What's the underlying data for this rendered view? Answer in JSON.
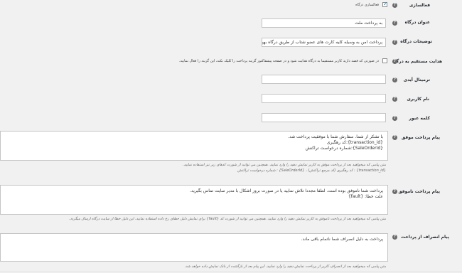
{
  "fields": {
    "enabled": {
      "label": "فعالسازی",
      "checkbox_label": "فعالسازی درگاه"
    },
    "title": {
      "label": "عنوان درگاه",
      "value": "به پرداخت ملت"
    },
    "description": {
      "label": "توضیحات درگاه",
      "value": "پرداخت امن به وسیله کلیه کارت های عضو شتاب از طریق درگاه بهپرداخت ملت"
    },
    "direct_redirect": {
      "label": "هدایت مستقیم به درگاه",
      "checkbox_label": "در صورتی که قصد دارید کاربر مستقیما به درگاه هدایت شود و در صفحه پیشفاکتور گزینه پرداخت را کلیک نکند، این گزینه را فعال نمایید."
    },
    "terminal": {
      "label": "ترمینال آیدی",
      "value": ""
    },
    "username": {
      "label": "نام کاربری",
      "value": ""
    },
    "password": {
      "label": "کلمه عبور",
      "value": ""
    },
    "success_message": {
      "label": "پیام پرداخت موفق",
      "lines": [
        "با تشکر از شما. سفارش شما با موفقیت پرداخت شد.",
        "{transaction_id}:کد رهگیری",
        "{SaleOrderId}:شماره درخواست تراکنش"
      ],
      "desc_1": "متن پیامی که میخواهید بعد از پرداخت موفق به کاربر نمایش دهید را وارد نمایید. همچنین می توانید از شورت کدهای زیر نیز استفاده نمایید.",
      "desc_2": "{transaction_id} : کد رهگیری (کد مرجع تراکنش) ، {SaleOrderId} : شماره درخواست تراکنش"
    },
    "failed_message": {
      "label": "پیام پرداخت ناموفق",
      "lines": [
        "پرداخت شما ناموفق بوده است. لطفا مجددا تلاش نمایید یا در صورت بروز اشکال با مدیر سایت تماس بگیرید.",
        "علت خطا: {fault}"
      ],
      "desc_1": "متن پیامی که میخواهید بعد از پرداخت ناموفق به کاربر نمایش دهید را وارد نمایید. همچنین می توانید از شورت کد {fault} برای نمایش دلیل خطای رخ داده استفاده نمایید. این دلیل خطا از سایت درگاه ارسال میگردد."
    },
    "cancel_message": {
      "label": "پیام انصراف از پرداخت",
      "lines": [
        "پرداخت به دلیل انصراف شما ناتمام باقی ماند."
      ],
      "desc_1": "متن پیامی که میخواهید بعد از انصراف کاربر از پرداخت نمایش دهید را وارد نمایید. این پیام بعد از بازگشت از بانک نمایش داده خواهد شد."
    }
  },
  "help_glyph": "?",
  "colors": {
    "page_bg": "#f1f1f1",
    "checkbox_check": "#1e8cbe",
    "help_icon_bg": "#6b6b6b"
  }
}
